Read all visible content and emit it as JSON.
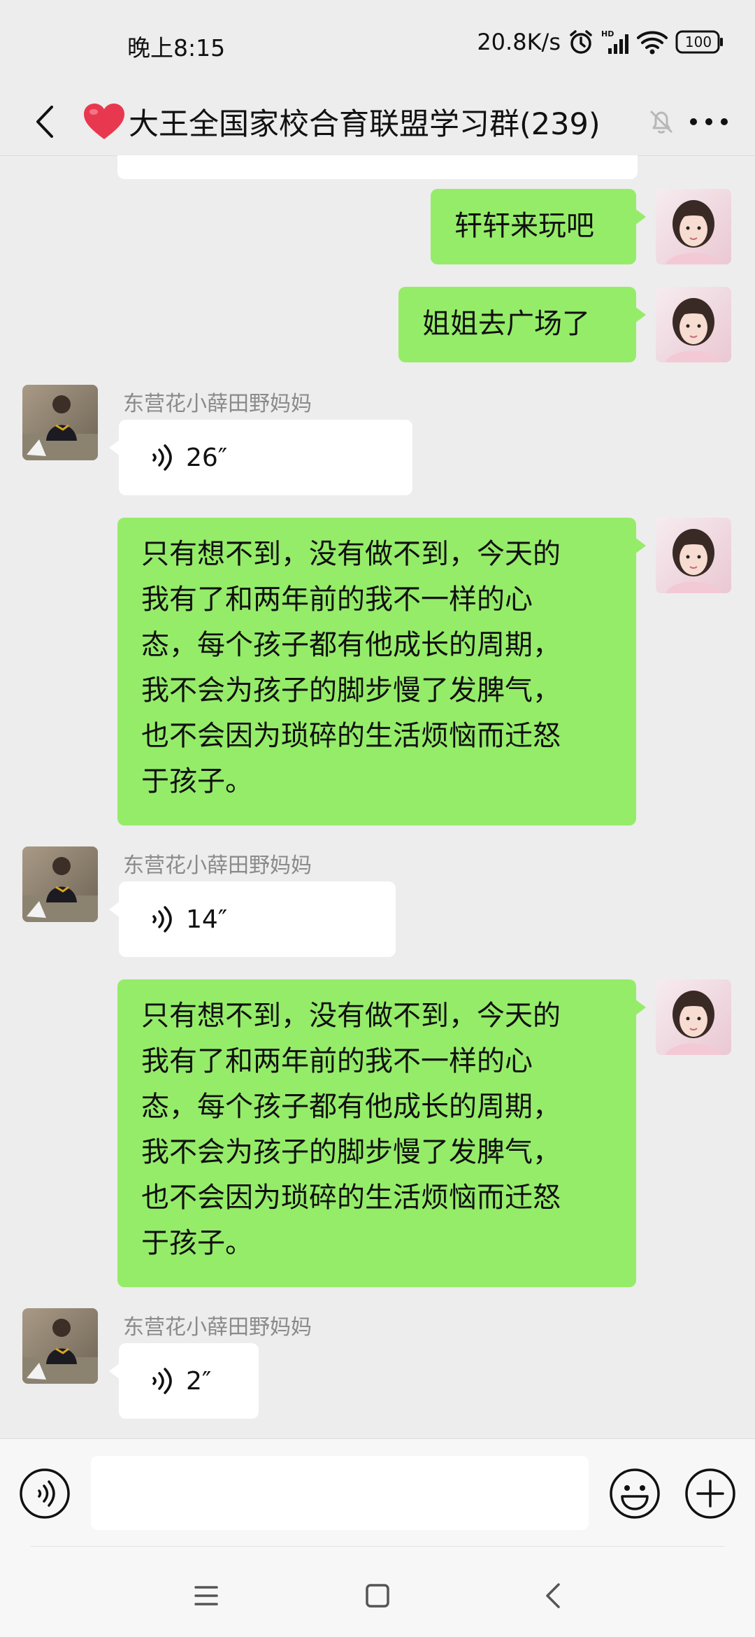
{
  "status_bar": {
    "time": "晚上8:15",
    "speed": "20.8K/s",
    "battery": "100",
    "icons": [
      "alarm-icon",
      "hd-signal-icon",
      "wifi-icon",
      "battery-icon"
    ]
  },
  "header": {
    "title": "大王全国家校合育联盟学习群(239)",
    "title_icon": "heart-icon",
    "back_icon": "back-arrow-icon",
    "mute_icon": "muted-bell-icon",
    "more_icon": "more-icon"
  },
  "messages": [
    {
      "type": "text",
      "side": "right",
      "text": "轩轩来玩吧"
    },
    {
      "type": "text",
      "side": "right",
      "text": "姐姐去广场了"
    },
    {
      "type": "voice",
      "side": "left",
      "sender": "东营花小薛田野妈妈",
      "duration": "26″"
    },
    {
      "type": "text",
      "side": "right",
      "lines": [
        "只有想不到，没有做不到，今天的",
        "我有了和两年前的我不一样的心",
        "态，每个孩子都有他成长的周期，",
        "我不会为孩子的脚步慢了发脾气，",
        "也不会因为琐碎的生活烦恼而迁怒",
        "于孩子。"
      ]
    },
    {
      "type": "voice",
      "side": "left",
      "sender": "东营花小薛田野妈妈",
      "duration": "14″"
    },
    {
      "type": "text",
      "side": "right",
      "lines": [
        "只有想不到，没有做不到，今天的",
        "我有了和两年前的我不一样的心",
        "态，每个孩子都有他成长的周期，",
        "我不会为孩子的脚步慢了发脾气，",
        "也不会因为琐碎的生活烦恼而迁怒",
        "于孩子。"
      ]
    },
    {
      "type": "voice",
      "side": "left",
      "sender": "东营花小薛田野妈妈",
      "duration": "2″"
    }
  ],
  "input_bar": {
    "voice_icon": "voice-mode-icon",
    "input_value": "",
    "emoji_icon": "emoji-icon",
    "plus_icon": "plus-icon"
  },
  "nav_bar": {
    "icons": [
      "menu-icon",
      "home-icon",
      "back-icon"
    ]
  },
  "colors": {
    "background": "#ededed",
    "bubble_self": "#95ec69",
    "bubble_other": "#ffffff",
    "sender_name": "#8a8a8a",
    "heart": "#e8384f"
  }
}
